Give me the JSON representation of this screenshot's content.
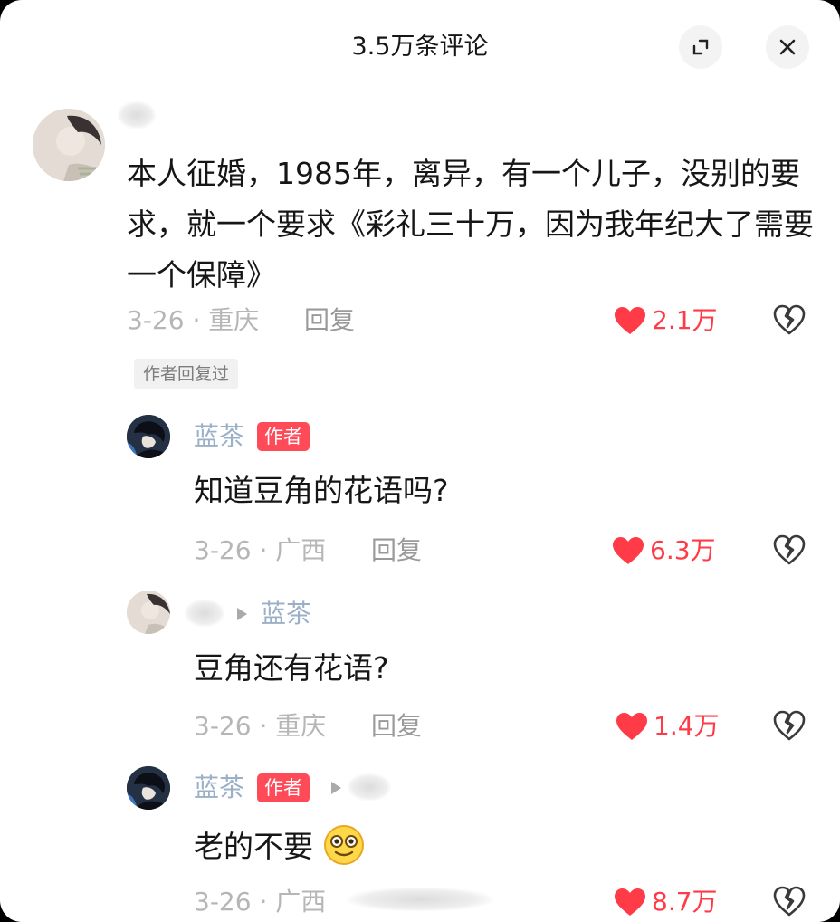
{
  "header": {
    "title": "3.5万条评论"
  },
  "main_comment": {
    "text": "本人征婚，1985年，离异，有一个儿子，没别的要求，就一个要求《彩礼三十万，因为我年纪大了需要一个保障》",
    "meta": "3-26 · 重庆",
    "reply_label": "回复",
    "likes": "2.1万",
    "author_replied_chip": "作者回复过"
  },
  "replies": [
    {
      "username": "蓝茶",
      "badge": "作者",
      "text": "知道豆角的花语吗?",
      "meta": "3-26 · 广西",
      "reply_label": "回复",
      "likes": "6.3万"
    },
    {
      "reply_to": "蓝茶",
      "text": "豆角还有花语?",
      "meta": "3-26 · 重庆",
      "reply_label": "回复",
      "likes": "1.4万"
    },
    {
      "username": "蓝茶",
      "badge": "作者",
      "text": "老的不要",
      "meta": "3-26 · 广西",
      "likes": "8.7万"
    }
  ],
  "colors": {
    "like": "#ff3b47",
    "badge": "#ff4a58",
    "username": "#9bb0c8",
    "meta": "#b6b6b6"
  },
  "icons": [
    "expand-icon",
    "close-icon",
    "heart-icon",
    "broken-heart-icon",
    "play-arrow-icon",
    "smile-emoji-icon"
  ]
}
